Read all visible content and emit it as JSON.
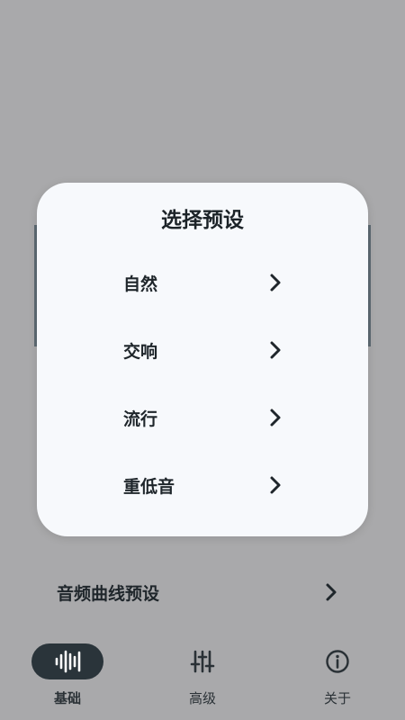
{
  "dialog": {
    "title": "选择预设",
    "options": [
      {
        "label": "自然"
      },
      {
        "label": "交响"
      },
      {
        "label": "流行"
      },
      {
        "label": "重低音"
      }
    ]
  },
  "background": {
    "preset_row_label": "音频曲线预设"
  },
  "nav": {
    "items": [
      {
        "label": "基础",
        "icon": "waveform-icon",
        "active": true
      },
      {
        "label": "高级",
        "icon": "sliders-icon",
        "active": false
      },
      {
        "label": "关于",
        "icon": "info-icon",
        "active": false
      }
    ]
  },
  "colors": {
    "scrim": "#a9a9ab",
    "dialog_bg": "#f7f9fc",
    "active_pill": "#2a343a",
    "text_dark": "#1f262b"
  }
}
